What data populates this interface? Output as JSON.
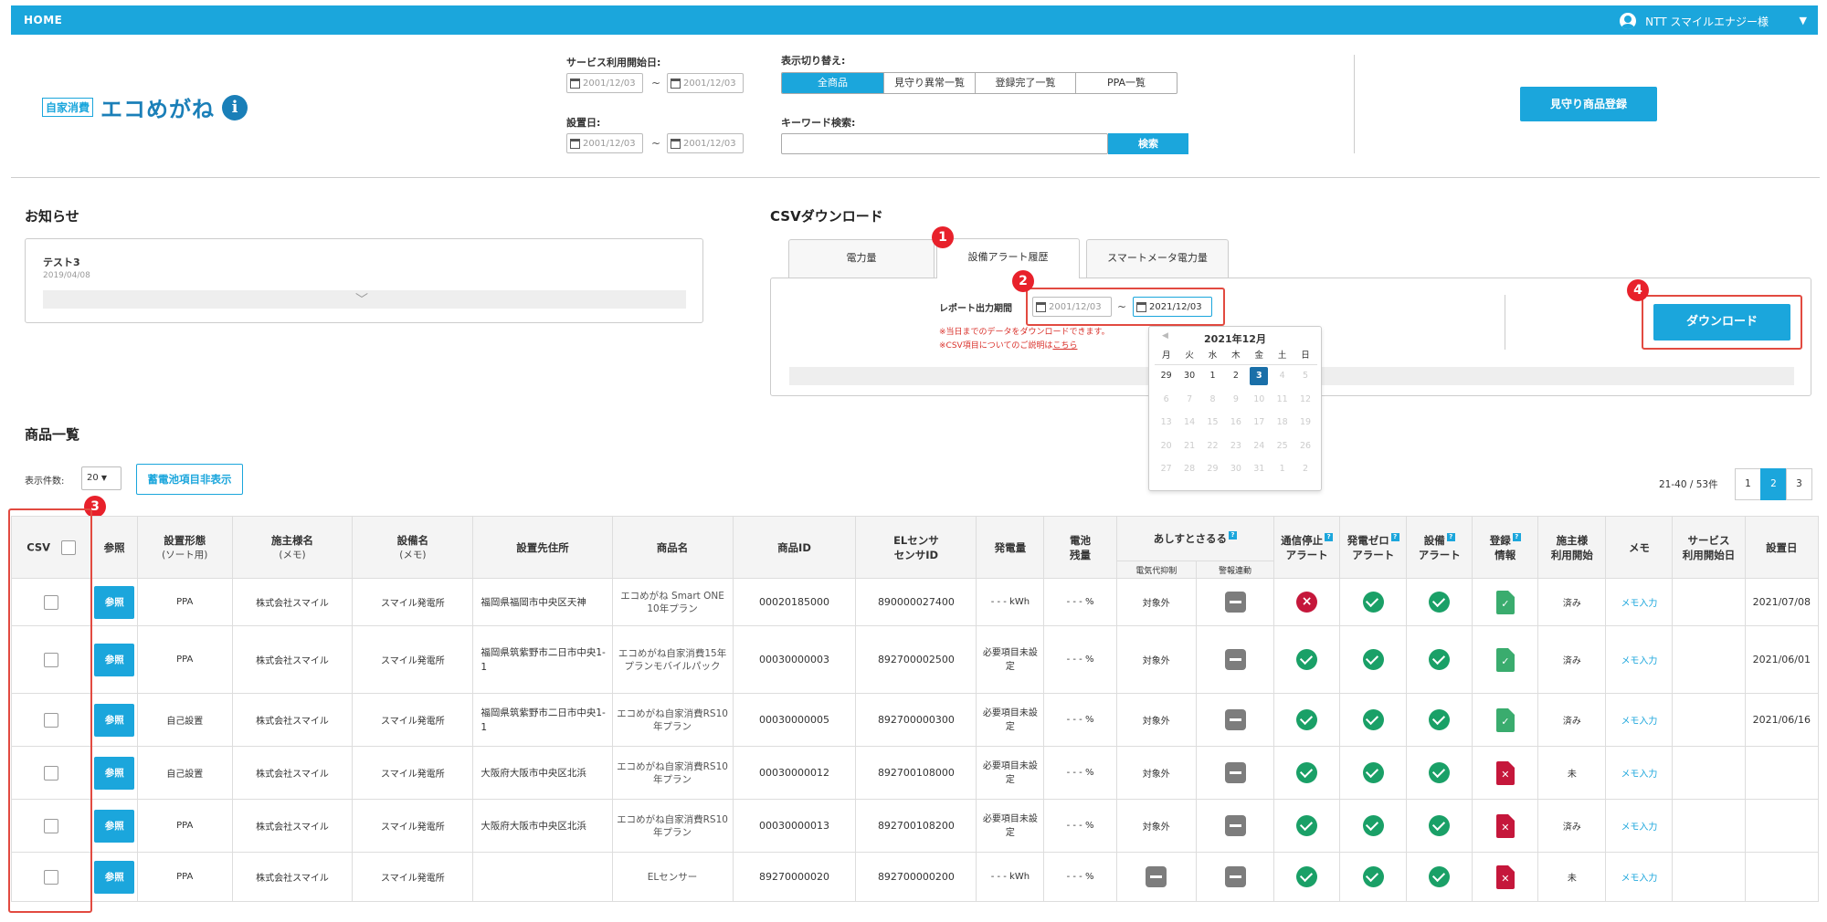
{
  "header": {
    "home": "HOME",
    "user": "NTT スマイルエナジー様"
  },
  "logo": {
    "badge": "自家消費",
    "name": "エコめがね",
    "info": "i"
  },
  "filters": {
    "service_start_label": "サービス利用開始日:",
    "install_date_label": "設置日:",
    "date_from": "2001/12/03",
    "date_to": "2001/12/03",
    "tilde": "~",
    "view_switch_label": "表示切り替え:",
    "view_tabs": [
      "全商品",
      "見守り異常一覧",
      "登録完了一覧",
      "PPA一覧"
    ],
    "keyword_label": "キーワード検索:",
    "search_button": "検索"
  },
  "register_button": "見守り商品登録",
  "notice": {
    "heading": "お知らせ",
    "title": "テスト3",
    "date": "2019/04/08"
  },
  "csv": {
    "heading": "CSVダウンロード",
    "tabs": [
      "電力量",
      "設備アラート履歴",
      "スマートメータ電力量"
    ],
    "active_tab": "設備アラート履歴",
    "period_label": "レポート出力期間",
    "date_from": "2001/12/03",
    "date_to": "2021/12/03",
    "note1": "※当日までのデータをダウンロードできます。",
    "note2_prefix": "※CSV項目についてのご説明は",
    "note2_link": "こちら",
    "download_button": "ダウンロード"
  },
  "annotations": [
    "1",
    "2",
    "3",
    "4"
  ],
  "calendar": {
    "title": "2021年12月",
    "weekdays": [
      "月",
      "火",
      "水",
      "木",
      "金",
      "土",
      "日"
    ],
    "days": [
      "29",
      "30",
      "1",
      "2",
      "3",
      "4",
      "5",
      "6",
      "7",
      "8",
      "9",
      "10",
      "11",
      "12",
      "13",
      "14",
      "15",
      "16",
      "17",
      "18",
      "19",
      "20",
      "21",
      "22",
      "23",
      "24",
      "25",
      "26",
      "27",
      "28",
      "29",
      "30",
      "31",
      "1",
      "2"
    ],
    "selected_day": "3"
  },
  "product_list": {
    "heading": "商品一覧",
    "per_page_label": "表示件数:",
    "per_page_value": "20",
    "battery_toggle": "蓄電池項目非表示",
    "page_info": "21-40 / 53件",
    "pages": [
      "1",
      "2",
      "3"
    ],
    "current_page": "2"
  },
  "table": {
    "headers": {
      "csv": "CSV",
      "ref": "参照",
      "install_type": "設置形態",
      "install_type_sub": "(ソート用)",
      "owner": "施主様名",
      "owner_sub": "(メモ)",
      "facility": "設備名",
      "facility_sub": "(メモ)",
      "address": "設置先住所",
      "product_name": "商品名",
      "product_id": "商品ID",
      "el_sensor": "ELセンサ",
      "el_sensor2": "センサID",
      "generation": "発電量",
      "battery": "電池",
      "battery2": "残量",
      "ashisuto": "あしすとさるる",
      "ashisuto_sub1": "電気代抑制",
      "ashisuto_sub2": "警報連動",
      "comm_stop": "通信停止",
      "comm_stop2": "アラート",
      "gen_zero": "発電ゼロ",
      "gen_zero2": "アラート",
      "equip": "設備",
      "equip2": "アラート",
      "reg": "登録",
      "reg2": "情報",
      "owner_use": "施主様",
      "owner_use2": "利用開始",
      "memo": "メモ",
      "service": "サービス",
      "service2": "利用開始日",
      "install_date": "設置日"
    },
    "rows": [
      {
        "ref": "参照",
        "type": "PPA",
        "owner": "株式会社スマイル",
        "facility": "スマイル発電所",
        "address": "福岡県福岡市中央区天神",
        "product": "エコめがね Smart ONE 10年プラン",
        "product_id": "00020185000",
        "sensor_id": "890000027400",
        "generation": "- - - kWh",
        "battery": "- - - %",
        "ashisuto1": "対象外",
        "ashisuto2": "dash",
        "comm": "ng",
        "gen_zero": "ok",
        "equip": "ok",
        "reg": "green",
        "owner_use": "済み",
        "memo": "メモ入力",
        "service_date": "",
        "install_date": "2021/07/08"
      },
      {
        "ref": "参照",
        "type": "PPA",
        "owner": "株式会社スマイル",
        "facility": "スマイル発電所",
        "address": "福岡県筑紫野市二日市中央1-1",
        "product": "エコめがね自家消費15年プランモバイルパック",
        "product_id": "00030000003",
        "sensor_id": "892700002500",
        "generation": "必要項目未設定",
        "battery": "- - - %",
        "ashisuto1": "対象外",
        "ashisuto2": "dash",
        "comm": "ok",
        "gen_zero": "ok",
        "equip": "ok",
        "reg": "green",
        "owner_use": "済み",
        "memo": "メモ入力",
        "service_date": "",
        "install_date": "2021/06/01"
      },
      {
        "ref": "参照",
        "type": "自己設置",
        "owner": "株式会社スマイル",
        "facility": "スマイル発電所",
        "address": "福岡県筑紫野市二日市中央1-1",
        "product": "エコめがね自家消費RS10年プラン",
        "product_id": "00030000005",
        "sensor_id": "892700000300",
        "generation": "必要項目未設定",
        "battery": "- - - %",
        "ashisuto1": "対象外",
        "ashisuto2": "dash",
        "comm": "ok",
        "gen_zero": "ok",
        "equip": "ok",
        "reg": "green",
        "owner_use": "済み",
        "memo": "メモ入力",
        "service_date": "",
        "install_date": "2021/06/16"
      },
      {
        "ref": "参照",
        "type": "自己設置",
        "owner": "株式会社スマイル",
        "facility": "スマイル発電所",
        "address": "大阪府大阪市中央区北浜",
        "product": "エコめがね自家消費RS10年プラン",
        "product_id": "00030000012",
        "sensor_id": "892700108000",
        "generation": "必要項目未設定",
        "battery": "- - - %",
        "ashisuto1": "対象外",
        "ashisuto2": "dash",
        "comm": "ok",
        "gen_zero": "ok",
        "equip": "ok",
        "reg": "red",
        "owner_use": "未",
        "memo": "メモ入力",
        "service_date": "",
        "install_date": ""
      },
      {
        "ref": "参照",
        "type": "PPA",
        "owner": "株式会社スマイル",
        "facility": "スマイル発電所",
        "address": "大阪府大阪市中央区北浜",
        "product": "エコめがね自家消費RS10年プラン",
        "product_id": "00030000013",
        "sensor_id": "892700108200",
        "generation": "必要項目未設定",
        "battery": "- - - %",
        "ashisuto1": "対象外",
        "ashisuto2": "dash",
        "comm": "ok",
        "gen_zero": "ok",
        "equip": "ok",
        "reg": "red",
        "owner_use": "済み",
        "memo": "メモ入力",
        "service_date": "",
        "install_date": ""
      },
      {
        "ref": "参照",
        "type": "PPA",
        "owner": "株式会社スマイル",
        "facility": "スマイル発電所",
        "address": "",
        "product": "ELセンサー",
        "product_id": "89270000020",
        "sensor_id": "892700000200",
        "generation": "- - - kWh",
        "battery": "- - - %",
        "ashisuto1": "dash",
        "ashisuto2": "dash",
        "comm": "ok",
        "gen_zero": "ok",
        "equip": "ok",
        "reg": "red",
        "owner_use": "未",
        "memo": "メモ入力",
        "service_date": "",
        "install_date": ""
      }
    ]
  }
}
